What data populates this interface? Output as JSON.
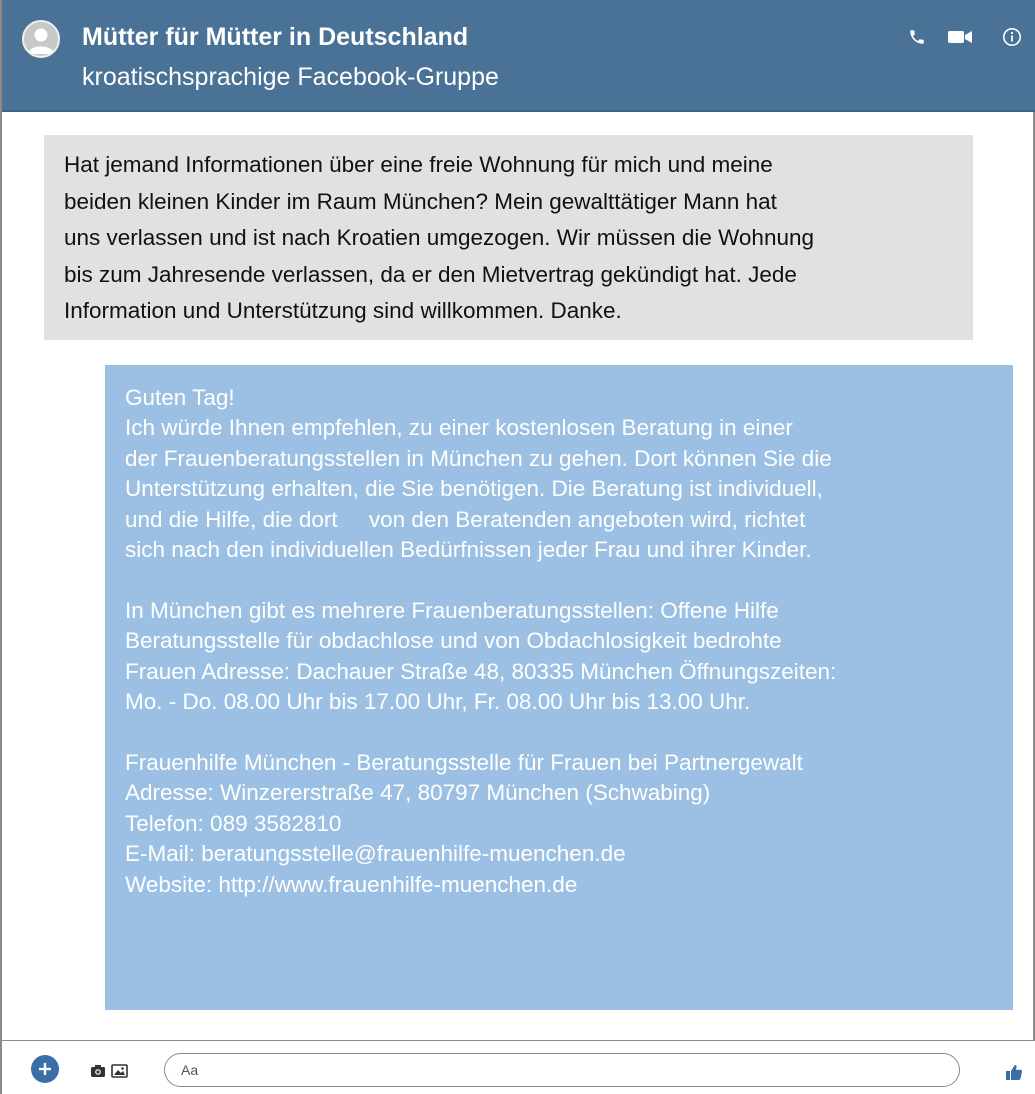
{
  "header": {
    "title": "Mütter für Mütter in Deutschland",
    "subtitle": "kroatischsprachige Facebook-Gruppe",
    "icons": [
      "avatar-placeholder",
      "phone-icon",
      "video-camera-icon",
      "info-icon"
    ]
  },
  "colors": {
    "header_bg": "#4a7296",
    "incoming_bubble": "#e1e1e1",
    "outgoing_bubble": "#9bc0e4",
    "accent": "#3a6ea8"
  },
  "messages": {
    "incoming": {
      "lines": [
        "Hat jemand Informationen über eine freie Wohnung für mich und meine",
        "beiden kleinen Kinder im Raum München? Mein gewalttätiger Mann hat",
        "uns verlassen und ist nach Kroatien umgezogen. Wir müssen die Wohnung",
        "bis zum Jahresende verlassen, da er den Mietvertrag gekündigt hat. Jede",
        "Information und Unterstützung sind willkommen. Danke."
      ]
    },
    "outgoing": {
      "lines": [
        "Guten Tag!",
        "Ich würde Ihnen empfehlen, zu einer kostenlosen Beratung in einer",
        "der Frauenberatungsstellen in München zu gehen. Dort können Sie die",
        "Unterstützung erhalten, die Sie benötigen. Die Beratung ist individuell,",
        "und die Hilfe, die dort     von den Beratenden angeboten wird, richtet",
        "sich nach den individuellen Bedürfnissen jeder Frau und ihrer Kinder.",
        "",
        "In München gibt es mehrere Frauenberatungsstellen: Offene Hilfe",
        "Beratungsstelle für obdachlose und von Obdachlosigkeit bedrohte",
        "Frauen Adresse: Dachauer Straße 48, 80335 München Öffnungszeiten:",
        "Mo. - Do. 08.00 Uhr bis 17.00 Uhr, Fr. 08.00 Uhr bis 13.00 Uhr.",
        "",
        "Frauenhilfe München - Beratungsstelle für Frauen bei Partnergewalt",
        "Adresse: Winzererstraße 47, 80797 München (Schwabing)",
        "Telefon: 089 3582810",
        "E-Mail: beratungsstelle@frauenhilfe-muenchen.de",
        "Website: http://www.frauenhilfe-muenchen.de"
      ]
    }
  },
  "composer": {
    "placeholder": "Aa",
    "icons": [
      "plus-icon",
      "camera-icon",
      "image-icon",
      "thumbs-up-icon"
    ]
  }
}
